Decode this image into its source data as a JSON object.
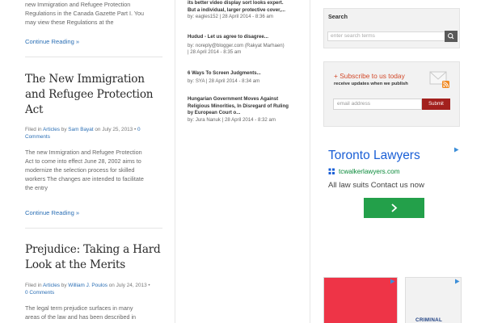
{
  "posts": {
    "intro_lines": [
      "new Immigration and Refugee Protection",
      "Regulations in the Canada Gazette Part I. You",
      "may view these Regulations at the"
    ],
    "continue_label": "Continue Reading »",
    "items": [
      {
        "title_lines": [
          "The New Immigration",
          "and Refugee Protection",
          "Act"
        ],
        "meta_prefix": "Filed in ",
        "category": "Articles",
        "meta_by": " by ",
        "author": "Sam Bayat",
        "meta_date": " on July 25, 2013 • ",
        "comments_num": "0",
        "comments_label": "Comments",
        "body_lines": [
          "The new Immigration and Refugee Protection",
          "Act to come into effect June 28, 2002 aims to",
          "modernize the selection process for skilled",
          "workers The changes are intended to facilitate",
          "the entry"
        ]
      },
      {
        "title_lines": [
          "Prejudice: Taking a Hard",
          "Look at the Merits"
        ],
        "meta_prefix": "Filed in ",
        "category": "Articles",
        "meta_by": " by ",
        "author": "William J. Poulos",
        "meta_date": " on July 24, 2013 •",
        "comments_num": "0",
        "comments_label": "Comments",
        "body_lines": [
          "The legal term prejudice surfaces in many",
          "areas of the law and has been described in"
        ]
      }
    ]
  },
  "recent_comments": [
    {
      "title_lines": [
        "its better video display sort looks expert.",
        "But a individual, larger protective cover,..."
      ],
      "by_lines": [
        "by: eagles152 | 28 April 2014 - 8:36 am"
      ]
    },
    {
      "title_lines": [
        "Hudud - Let us agree to disagree..."
      ],
      "by_lines": [
        "by: noreply@blogger.com (Rakyat Marhaen)",
        "| 28 April 2014 - 8:35 am"
      ]
    },
    {
      "title_lines": [
        "6 Ways To Screen Judgments..."
      ],
      "by_lines": [
        "by: SYA | 28 April 2014 - 8:34 am"
      ]
    },
    {
      "title_lines": [
        "Hungarian Government Moves Against",
        "Religious Minorities, In Disregard of Ruling",
        "by European Court o..."
      ],
      "by_lines": [
        "by: Jura Nanuk | 28 April 2014 - 8:32 am"
      ]
    }
  ],
  "sidebar": {
    "search": {
      "title": "Search",
      "placeholder": "enter search terms"
    },
    "subscribe": {
      "title": "+ Subscribe to us today",
      "subtitle": "receive updates when we publish",
      "email_placeholder": "email address",
      "button_label": "Submit"
    },
    "ad": {
      "headline": "Toronto Lawyers",
      "url": "tcwalkerlawyers.com",
      "description": "All law suits Contact us now"
    },
    "ad3_text": "CRIMINAL"
  },
  "colors": {
    "link": "#2b6fb5",
    "subscribe_accent": "#d2492a",
    "submit_button": "#a3201d",
    "ad_headline": "#1a5fd6",
    "ad_url": "#0a8a3a",
    "ad_button": "#23a04a",
    "ad_red": "#ee3447"
  }
}
